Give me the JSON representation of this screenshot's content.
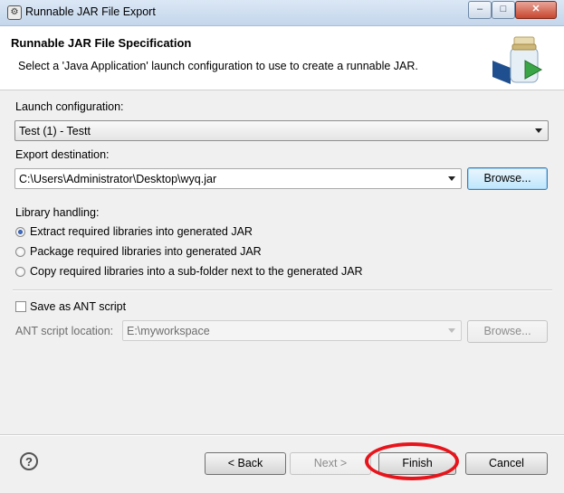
{
  "window": {
    "title": "Runnable JAR File Export",
    "controls": {
      "minimize": "–",
      "maximize": "□",
      "close": "✕"
    }
  },
  "header": {
    "title": "Runnable JAR File Specification",
    "description": "Select a 'Java Application' launch configuration to use to create a runnable JAR."
  },
  "launch": {
    "label": "Launch configuration:",
    "value": "Test (1) - Testt"
  },
  "export": {
    "label": "Export destination:",
    "value": "C:\\Users\\Administrator\\Desktop\\wyq.jar",
    "browse": "Browse..."
  },
  "library": {
    "label": "Library handling:",
    "options": [
      {
        "label": "Extract required libraries into generated JAR",
        "checked": true
      },
      {
        "label": "Package required libraries into generated JAR",
        "checked": false
      },
      {
        "label": "Copy required libraries into a sub-folder next to the generated JAR",
        "checked": false
      }
    ]
  },
  "ant": {
    "checkbox_label": "Save as ANT script",
    "checked": false,
    "location_label": "ANT script location:",
    "location_value": "E:\\myworkspace",
    "browse": "Browse..."
  },
  "footer": {
    "help_icon": "?",
    "back": "< Back",
    "next": "Next >",
    "finish": "Finish",
    "cancel": "Cancel"
  },
  "annotation": {
    "color": "#e8141b"
  }
}
